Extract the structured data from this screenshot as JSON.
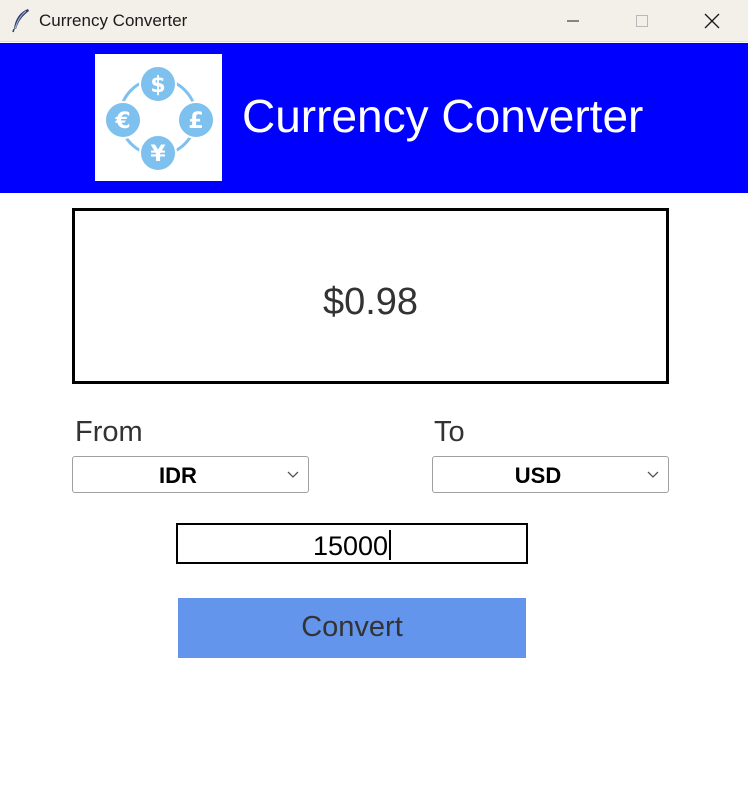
{
  "window": {
    "title": "Currency Converter",
    "icon": "feather-icon"
  },
  "header": {
    "title": "Currency Converter",
    "logo": "currency-exchange-logo",
    "background_color": "#0000ff"
  },
  "result": {
    "value": "$0.98"
  },
  "from": {
    "label": "From",
    "selected": "IDR"
  },
  "to": {
    "label": "To",
    "selected": "USD"
  },
  "amount": {
    "value": "15000"
  },
  "convert": {
    "label": "Convert",
    "color": "#6495ed"
  }
}
